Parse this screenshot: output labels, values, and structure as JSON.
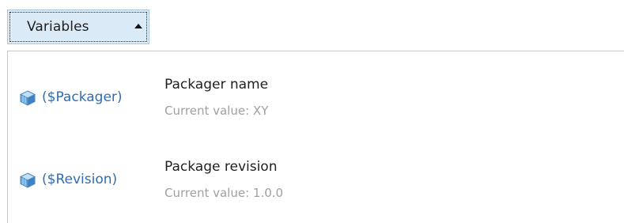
{
  "toolbar": {
    "dropdown_label": "Variables"
  },
  "variables": {
    "current_value_prefix": "Current value:",
    "items": [
      {
        "name": "($Packager)",
        "title": "Packager name",
        "value": "XY",
        "icon": "cube-icon"
      },
      {
        "name": "($Revision)",
        "title": "Package revision",
        "value": "1.0.0",
        "icon": "cube-icon"
      }
    ]
  },
  "colors": {
    "button_bg": "#dbeaf7",
    "link": "#2e6db4",
    "secondary_text": "#a0a0a0"
  }
}
